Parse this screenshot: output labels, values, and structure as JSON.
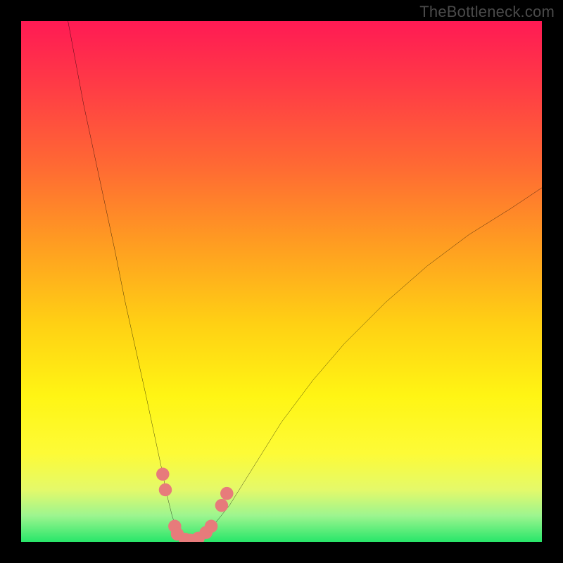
{
  "watermark": "TheBottleneck.com",
  "chart_data": {
    "type": "line",
    "title": "",
    "xlabel": "",
    "ylabel": "",
    "xlim": [
      0,
      100
    ],
    "ylim": [
      0,
      100
    ],
    "gradient_stops": [
      {
        "pos": 0,
        "color": "#ff1a54"
      },
      {
        "pos": 12,
        "color": "#ff3a46"
      },
      {
        "pos": 28,
        "color": "#ff6a33"
      },
      {
        "pos": 42,
        "color": "#ff9a22"
      },
      {
        "pos": 58,
        "color": "#ffd014"
      },
      {
        "pos": 72,
        "color": "#fff514"
      },
      {
        "pos": 83,
        "color": "#fdfb37"
      },
      {
        "pos": 90,
        "color": "#e4f96a"
      },
      {
        "pos": 95,
        "color": "#9cf58f"
      },
      {
        "pos": 100,
        "color": "#28e66a"
      }
    ],
    "series": [
      {
        "name": "left-curve",
        "x": [
          9,
          12,
          15,
          18,
          20,
          22,
          24,
          25.5,
          27,
          28,
          29,
          30,
          31,
          32
        ],
        "y": [
          100,
          84,
          70,
          56,
          46,
          37,
          28,
          21,
          14,
          9,
          5,
          2,
          0.5,
          0
        ]
      },
      {
        "name": "right-curve",
        "x": [
          33,
          34,
          36,
          40,
          45,
          50,
          56,
          62,
          70,
          78,
          86,
          94,
          100
        ],
        "y": [
          0,
          0.5,
          2,
          7,
          15,
          23,
          31,
          38,
          46,
          53,
          59,
          64,
          68
        ]
      }
    ],
    "marker_points": {
      "name": "highlighted-points",
      "color": "#e77b7b",
      "points": [
        {
          "x": 27.2,
          "y": 13
        },
        {
          "x": 27.7,
          "y": 10
        },
        {
          "x": 29.5,
          "y": 3
        },
        {
          "x": 30.0,
          "y": 1.5
        },
        {
          "x": 31.5,
          "y": 0.5
        },
        {
          "x": 32.5,
          "y": 0.3
        },
        {
          "x": 34.0,
          "y": 0.7
        },
        {
          "x": 35.5,
          "y": 1.8
        },
        {
          "x": 36.5,
          "y": 3.0
        },
        {
          "x": 38.5,
          "y": 7.0
        },
        {
          "x": 39.5,
          "y": 9.3
        }
      ]
    }
  }
}
